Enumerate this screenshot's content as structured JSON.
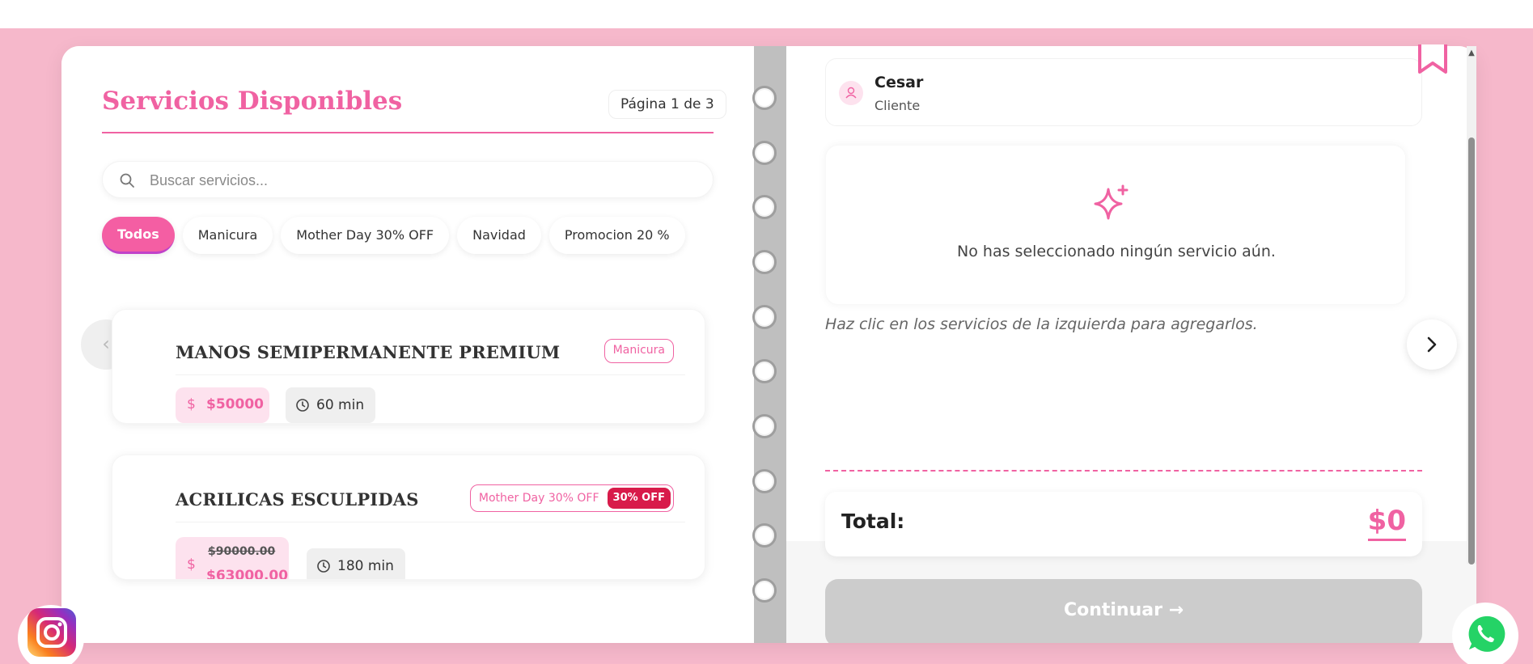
{
  "services": {
    "title": "Servicios Disponibles",
    "page_indicator": "Página 1 de 3",
    "search_placeholder": "Buscar servicios...",
    "filters": [
      {
        "label": "Todos",
        "active": true
      },
      {
        "label": "Manicura",
        "active": false
      },
      {
        "label": "Mother Day 30% OFF",
        "active": false
      },
      {
        "label": "Navidad",
        "active": false
      },
      {
        "label": "Promocion 20 %",
        "active": false
      }
    ],
    "cards": [
      {
        "name": "MANOS SEMIPERMANENTE PREMIUM",
        "category": "Manicura",
        "price": "$50000",
        "duration": "60 min"
      },
      {
        "name": "ACRILICAS ESCULPIDAS",
        "category": "Mother Day 30% OFF",
        "discount_badge": "30% OFF",
        "original_price": "$90000.00",
        "price": "$63000.00",
        "duration": "180 min"
      }
    ],
    "currency_symbol": "$"
  },
  "summary": {
    "client_name": "Cesar",
    "client_role": "Cliente",
    "empty_message": "No has seleccionado ningún servicio aún.",
    "hint": "Haz clic en los servicios de la izquierda para agregarlos.",
    "total_label": "Total:",
    "total_value": "$0",
    "continue_label": "Continuar →"
  },
  "colors": {
    "accent": "#f062a2",
    "background": "#f6b8cb",
    "discount": "#d81b4a",
    "disabled": "#cccccc"
  },
  "icons": [
    "search-icon",
    "clock-icon",
    "user-icon",
    "sparkle-icon",
    "bookmark-icon",
    "chevron-left-icon",
    "chevron-right-icon",
    "instagram-icon",
    "whatsapp-icon"
  ]
}
